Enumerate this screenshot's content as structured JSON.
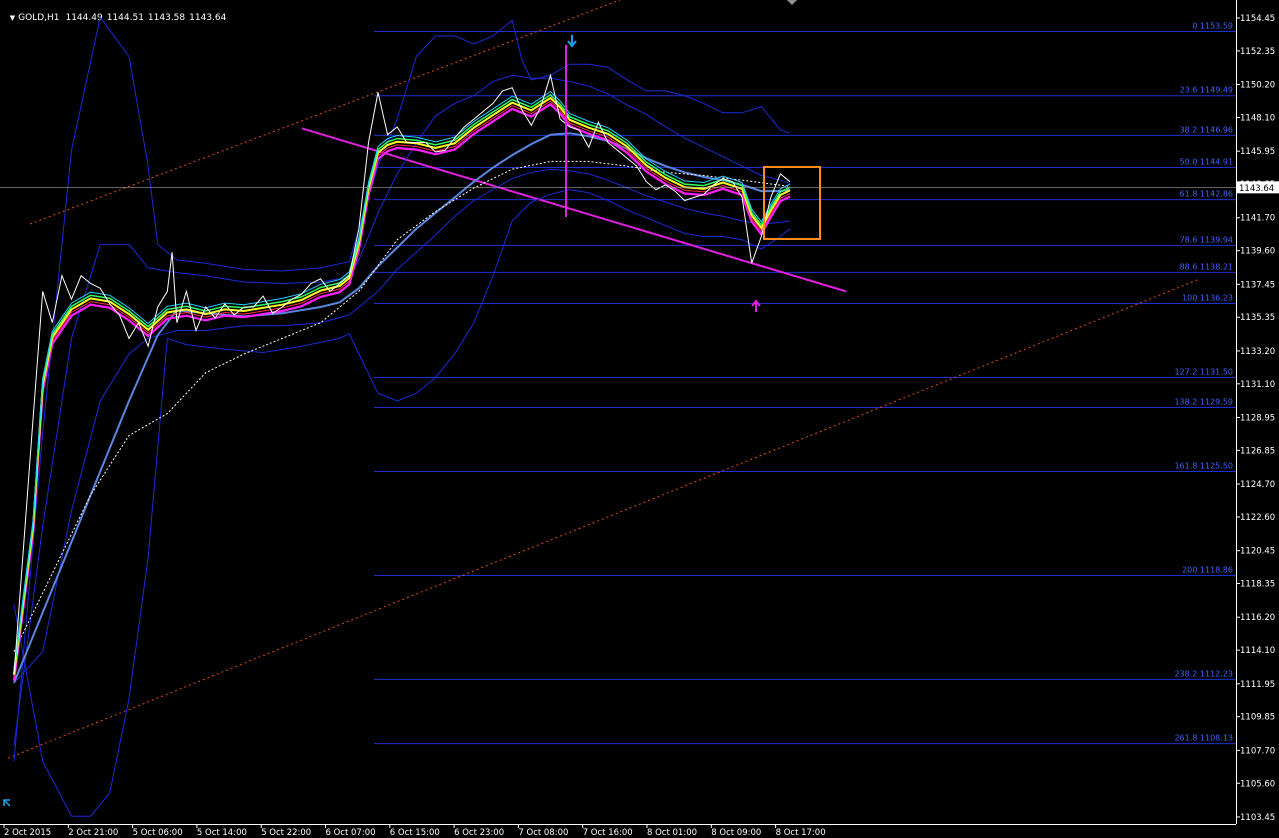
{
  "window": {
    "symbol": "GOLD,H1",
    "open": "1144.49",
    "high": "1144.51",
    "low": "1143.58",
    "close": "1143.64",
    "menu_icon": "triangle-down-icon"
  },
  "colors": {
    "background": "#000000",
    "axis": "#ffffff",
    "fib": "#2030d0",
    "fib_text": "#4060ff",
    "trend_magenta": "#e020e0",
    "channel_orange": "#e05010",
    "highlight_box": "#ff8c1a",
    "bollinger": "#1a2ad8",
    "ma_slow": "#5b86e0",
    "price": "#ffffff",
    "arrow_down": "#1ea0e8",
    "arrow_up": "#e020e0",
    "current_price_label_bg": "#ffffff"
  },
  "chart_data": {
    "type": "line",
    "instrument": "GOLD",
    "timeframe": "H1",
    "y_axis_ticks": [
      "1154.45",
      "1152.35",
      "1150.20",
      "1148.10",
      "1145.95",
      "1143.85",
      "1141.70",
      "1139.60",
      "1137.45",
      "1135.35",
      "1133.20",
      "1131.10",
      "1128.95",
      "1126.85",
      "1124.70",
      "1122.60",
      "1120.45",
      "1118.35",
      "1116.20",
      "1114.10",
      "1111.95",
      "1109.85",
      "1107.70",
      "1105.60",
      "1103.45"
    ],
    "x_axis_ticks": [
      "2 Oct 2015",
      "2 Oct 21:00",
      "5 Oct 06:00",
      "5 Oct 14:00",
      "5 Oct 22:00",
      "6 Oct 07:00",
      "6 Oct 15:00",
      "6 Oct 23:00",
      "7 Oct 08:00",
      "7 Oct 16:00",
      "8 Oct 01:00",
      "8 Oct 09:00",
      "8 Oct 17:00"
    ],
    "ylim": [
      1103.0,
      1155.6
    ],
    "current_price": "1143.64",
    "fibonacci_levels": [
      {
        "label": "0 1153.59",
        "price": 1153.59
      },
      {
        "label": "23.6 1149.49",
        "price": 1149.49
      },
      {
        "label": "38.2 1146.96",
        "price": 1146.96
      },
      {
        "label": "50.0 1144.91",
        "price": 1144.91
      },
      {
        "label": "61.8 1142.86",
        "price": 1142.86
      },
      {
        "label": "78.6 1139.94",
        "price": 1139.94
      },
      {
        "label": "88.6 1138.21",
        "price": 1138.21
      },
      {
        "label": "100 1136.23",
        "price": 1136.23
      },
      {
        "label": "127.2 1131.50",
        "price": 1131.5
      },
      {
        "label": "138.2 1129.59",
        "price": 1129.59
      },
      {
        "label": "161.8 1125.50",
        "price": 1125.5
      },
      {
        "label": "200 1118.86",
        "price": 1118.86
      },
      {
        "label": "238.2 1112.23",
        "price": 1112.23
      },
      {
        "label": "261.8 1108.13",
        "price": 1108.13
      }
    ],
    "price_series": [
      [
        0,
        1112.5
      ],
      [
        2,
        1129
      ],
      [
        3,
        1137
      ],
      [
        4,
        1135
      ],
      [
        5,
        1138
      ],
      [
        6,
        1136.5
      ],
      [
        7,
        1138
      ],
      [
        8,
        1137.5
      ],
      [
        9,
        1137.2
      ],
      [
        10,
        1136.2
      ],
      [
        11,
        1135.5
      ],
      [
        12,
        1134
      ],
      [
        13,
        1135
      ],
      [
        14,
        1133.5
      ],
      [
        15,
        1136
      ],
      [
        16,
        1137
      ],
      [
        16.5,
        1139.5
      ],
      [
        17,
        1135
      ],
      [
        18,
        1137
      ],
      [
        19,
        1134.5
      ],
      [
        20,
        1136
      ],
      [
        21,
        1135.3
      ],
      [
        22,
        1136.2
      ],
      [
        23,
        1135.5
      ],
      [
        24,
        1136
      ],
      [
        25,
        1136
      ],
      [
        26,
        1136.7
      ],
      [
        27,
        1135.6
      ],
      [
        28,
        1136
      ],
      [
        29,
        1136.5
      ],
      [
        30,
        1136.8
      ],
      [
        31,
        1137.5
      ],
      [
        32,
        1137.8
      ],
      [
        33,
        1137
      ],
      [
        34,
        1137.5
      ],
      [
        35,
        1138
      ],
      [
        36,
        1141
      ],
      [
        37,
        1146.5
      ],
      [
        38,
        1149.7
      ],
      [
        39,
        1147
      ],
      [
        40,
        1147.5
      ],
      [
        41,
        1146.5
      ],
      [
        42,
        1146.5
      ],
      [
        43,
        1146.5
      ],
      [
        44,
        1145.9
      ],
      [
        45,
        1146
      ],
      [
        46,
        1146.8
      ],
      [
        47,
        1147.5
      ],
      [
        48,
        1148
      ],
      [
        49,
        1148.5
      ],
      [
        50,
        1149
      ],
      [
        51,
        1149.8
      ],
      [
        52,
        1150
      ],
      [
        53,
        1148.6
      ],
      [
        54,
        1147.6
      ],
      [
        55,
        1148.8
      ],
      [
        56,
        1150.8
      ],
      [
        57,
        1148
      ],
      [
        58,
        1147.5
      ],
      [
        59,
        1147.3
      ],
      [
        60,
        1146.2
      ],
      [
        61,
        1147.8
      ],
      [
        62,
        1146.5
      ],
      [
        63,
        1146
      ],
      [
        64,
        1145.5
      ],
      [
        65,
        1145
      ],
      [
        66,
        1144
      ],
      [
        67,
        1143.5
      ],
      [
        68,
        1143.8
      ],
      [
        69,
        1143.4
      ],
      [
        70,
        1142.8
      ],
      [
        71,
        1143
      ],
      [
        72,
        1143.2
      ],
      [
        73,
        1143.8
      ],
      [
        74,
        1144.2
      ],
      [
        75,
        1144
      ],
      [
        76,
        1143
      ],
      [
        77,
        1138.8
      ],
      [
        78,
        1140.5
      ],
      [
        79,
        1143
      ],
      [
        80,
        1144.5
      ],
      [
        81,
        1144
      ]
    ],
    "fast_ma": [
      [
        0,
        1112.5
      ],
      [
        2,
        1122
      ],
      [
        3,
        1131
      ],
      [
        4,
        1134
      ],
      [
        6,
        1135.8
      ],
      [
        8,
        1136.5
      ],
      [
        10,
        1136.3
      ],
      [
        12,
        1135.5
      ],
      [
        14,
        1134.5
      ],
      [
        16,
        1135.6
      ],
      [
        18,
        1135.8
      ],
      [
        20,
        1135.5
      ],
      [
        22,
        1135.8
      ],
      [
        24,
        1135.7
      ],
      [
        26,
        1135.9
      ],
      [
        28,
        1136.1
      ],
      [
        30,
        1136.4
      ],
      [
        32,
        1137
      ],
      [
        34,
        1137.3
      ],
      [
        35,
        1137.8
      ],
      [
        36,
        1140
      ],
      [
        37,
        1143.5
      ],
      [
        38,
        1145.8
      ],
      [
        39,
        1146.3
      ],
      [
        40,
        1146.5
      ],
      [
        42,
        1146.4
      ],
      [
        44,
        1146.1
      ],
      [
        46,
        1146.4
      ],
      [
        48,
        1147.4
      ],
      [
        50,
        1148.2
      ],
      [
        52,
        1149
      ],
      [
        54,
        1148.5
      ],
      [
        56,
        1149.3
      ],
      [
        57,
        1148.7
      ],
      [
        58,
        1147.9
      ],
      [
        60,
        1147.4
      ],
      [
        62,
        1147
      ],
      [
        64,
        1146.2
      ],
      [
        66,
        1145
      ],
      [
        68,
        1144.2
      ],
      [
        70,
        1143.6
      ],
      [
        72,
        1143.5
      ],
      [
        74,
        1143.9
      ],
      [
        76,
        1143.5
      ],
      [
        77,
        1141.8
      ],
      [
        78,
        1141
      ],
      [
        79,
        1142.1
      ],
      [
        80,
        1143.1
      ],
      [
        81,
        1143.4
      ]
    ],
    "slow_ma": [
      [
        0,
        1112
      ],
      [
        3,
        1116.5
      ],
      [
        6,
        1121
      ],
      [
        9,
        1125.5
      ],
      [
        12,
        1130
      ],
      [
        15,
        1134.2
      ],
      [
        17,
        1135.8
      ],
      [
        20,
        1135.6
      ],
      [
        24,
        1135.4
      ],
      [
        28,
        1135.6
      ],
      [
        32,
        1136
      ],
      [
        34,
        1136.3
      ],
      [
        36,
        1137.2
      ],
      [
        38,
        1138.6
      ],
      [
        40,
        1139.8
      ],
      [
        42,
        1141
      ],
      [
        44,
        1142
      ],
      [
        46,
        1143
      ],
      [
        48,
        1144
      ],
      [
        50,
        1144.9
      ],
      [
        52,
        1145.7
      ],
      [
        54,
        1146.4
      ],
      [
        56,
        1147
      ],
      [
        58,
        1147.1
      ],
      [
        60,
        1146.9
      ],
      [
        62,
        1146.6
      ],
      [
        64,
        1146.1
      ],
      [
        66,
        1145.5
      ],
      [
        68,
        1145
      ],
      [
        70,
        1144.6
      ],
      [
        72,
        1144.3
      ],
      [
        74,
        1144.1
      ],
      [
        76,
        1143.8
      ],
      [
        78,
        1143.4
      ],
      [
        80,
        1143.4
      ],
      [
        81,
        1143.5
      ]
    ],
    "dotted_ma": [
      [
        0,
        1114
      ],
      [
        4,
        1119
      ],
      [
        8,
        1124
      ],
      [
        12,
        1127.8
      ],
      [
        16,
        1129.2
      ],
      [
        20,
        1131.8
      ],
      [
        24,
        1133
      ],
      [
        28,
        1134
      ],
      [
        32,
        1135
      ],
      [
        36,
        1137
      ],
      [
        40,
        1140.3
      ],
      [
        44,
        1142.1
      ],
      [
        48,
        1143.6
      ],
      [
        52,
        1144.8
      ],
      [
        56,
        1145.3
      ],
      [
        60,
        1145.3
      ],
      [
        64,
        1145
      ],
      [
        68,
        1144.6
      ],
      [
        72,
        1144.4
      ],
      [
        76,
        1144.1
      ],
      [
        81,
        1143.7
      ]
    ],
    "bollinger_upper": [
      [
        0,
        1107
      ],
      [
        3,
        1128
      ],
      [
        6,
        1146
      ],
      [
        9,
        1154.5
      ],
      [
        12,
        1152
      ],
      [
        14,
        1145
      ],
      [
        15,
        1140
      ],
      [
        17,
        1139
      ],
      [
        20,
        1138.8
      ],
      [
        24,
        1138.4
      ],
      [
        28,
        1138.3
      ],
      [
        32,
        1138.5
      ],
      [
        35,
        1138.9
      ],
      [
        36,
        1141
      ],
      [
        38,
        1145
      ],
      [
        40,
        1148
      ],
      [
        42,
        1152
      ],
      [
        44,
        1153.3
      ],
      [
        46,
        1153.3
      ],
      [
        48,
        1152.8
      ],
      [
        50,
        1153.3
      ],
      [
        52,
        1154.3
      ],
      [
        53,
        1151.8
      ],
      [
        54,
        1150.5
      ],
      [
        56,
        1150.8
      ],
      [
        58,
        1151.5
      ],
      [
        60,
        1151.5
      ],
      [
        62,
        1151.3
      ],
      [
        64,
        1150.5
      ],
      [
        66,
        1149.8
      ],
      [
        68,
        1149.8
      ],
      [
        70,
        1149.5
      ],
      [
        72,
        1149
      ],
      [
        74,
        1148.4
      ],
      [
        76,
        1148.4
      ],
      [
        78,
        1148.8
      ],
      [
        80,
        1147.3
      ],
      [
        81,
        1147.1
      ]
    ],
    "bollinger_lower": [
      [
        0,
        1117
      ],
      [
        3,
        1107
      ],
      [
        6,
        1103.5
      ],
      [
        8,
        1103.5
      ],
      [
        10,
        1105
      ],
      [
        12,
        1111
      ],
      [
        14,
        1120
      ],
      [
        15,
        1127
      ],
      [
        16,
        1134
      ],
      [
        18,
        1133.6
      ],
      [
        22,
        1133.3
      ],
      [
        26,
        1133.1
      ],
      [
        30,
        1133.5
      ],
      [
        34,
        1134
      ],
      [
        35,
        1134.3
      ],
      [
        36,
        1133
      ],
      [
        38,
        1130.5
      ],
      [
        40,
        1130
      ],
      [
        42,
        1130.5
      ],
      [
        44,
        1131.5
      ],
      [
        46,
        1133
      ],
      [
        48,
        1135
      ],
      [
        50,
        1138
      ],
      [
        52,
        1141.5
      ],
      [
        54,
        1142.7
      ],
      [
        56,
        1143.2
      ],
      [
        58,
        1143.5
      ],
      [
        60,
        1143.3
      ],
      [
        62,
        1142.8
      ],
      [
        64,
        1142.2
      ],
      [
        66,
        1141.7
      ],
      [
        68,
        1141.2
      ],
      [
        70,
        1140.7
      ],
      [
        72,
        1140.5
      ],
      [
        74,
        1140.5
      ],
      [
        76,
        1140.3
      ],
      [
        78,
        1139.7
      ],
      [
        80,
        1140.5
      ],
      [
        81,
        1141
      ]
    ],
    "bollinger_mid_upper": [
      [
        0,
        1108
      ],
      [
        3,
        1122
      ],
      [
        6,
        1134
      ],
      [
        9,
        1140
      ],
      [
        12,
        1140
      ],
      [
        14,
        1138.5
      ],
      [
        17,
        1138.2
      ],
      [
        20,
        1138
      ],
      [
        24,
        1137.6
      ],
      [
        28,
        1137.5
      ],
      [
        32,
        1137.6
      ],
      [
        35,
        1137.9
      ],
      [
        36,
        1139
      ],
      [
        38,
        1142
      ],
      [
        40,
        1144.5
      ],
      [
        42,
        1146.5
      ],
      [
        44,
        1148.2
      ],
      [
        46,
        1149
      ],
      [
        48,
        1149.5
      ],
      [
        50,
        1150.4
      ],
      [
        52,
        1150.8
      ],
      [
        54,
        1150.6
      ],
      [
        56,
        1150.6
      ],
      [
        58,
        1150.4
      ],
      [
        60,
        1150.1
      ],
      [
        62,
        1149.6
      ],
      [
        64,
        1148.9
      ],
      [
        66,
        1148.3
      ],
      [
        68,
        1147.5
      ],
      [
        70,
        1146.8
      ],
      [
        72,
        1146.2
      ],
      [
        74,
        1145.6
      ],
      [
        76,
        1145
      ],
      [
        78,
        1144.4
      ],
      [
        80,
        1144.1
      ],
      [
        81,
        1143.9
      ]
    ],
    "bollinger_mid_lower": [
      [
        0,
        1112
      ],
      [
        3,
        1114
      ],
      [
        6,
        1123
      ],
      [
        9,
        1130
      ],
      [
        12,
        1133
      ],
      [
        14,
        1134
      ],
      [
        17,
        1134.5
      ],
      [
        20,
        1134.5
      ],
      [
        24,
        1134.8
      ],
      [
        28,
        1134.8
      ],
      [
        32,
        1135
      ],
      [
        35,
        1135.5
      ],
      [
        36,
        1136
      ],
      [
        38,
        1137
      ],
      [
        40,
        1138.4
      ],
      [
        42,
        1139.5
      ],
      [
        44,
        1140.6
      ],
      [
        46,
        1141.8
      ],
      [
        48,
        1142.8
      ],
      [
        50,
        1143.5
      ],
      [
        52,
        1144.2
      ],
      [
        54,
        1144.6
      ],
      [
        56,
        1144.8
      ],
      [
        58,
        1144.7
      ],
      [
        60,
        1144.5
      ],
      [
        62,
        1144.1
      ],
      [
        64,
        1143.6
      ],
      [
        66,
        1143.1
      ],
      [
        68,
        1142.7
      ],
      [
        70,
        1142.3
      ],
      [
        72,
        1142
      ],
      [
        74,
        1141.8
      ],
      [
        76,
        1141.5
      ],
      [
        78,
        1141.3
      ],
      [
        80,
        1141.4
      ],
      [
        81,
        1141.5
      ]
    ]
  }
}
